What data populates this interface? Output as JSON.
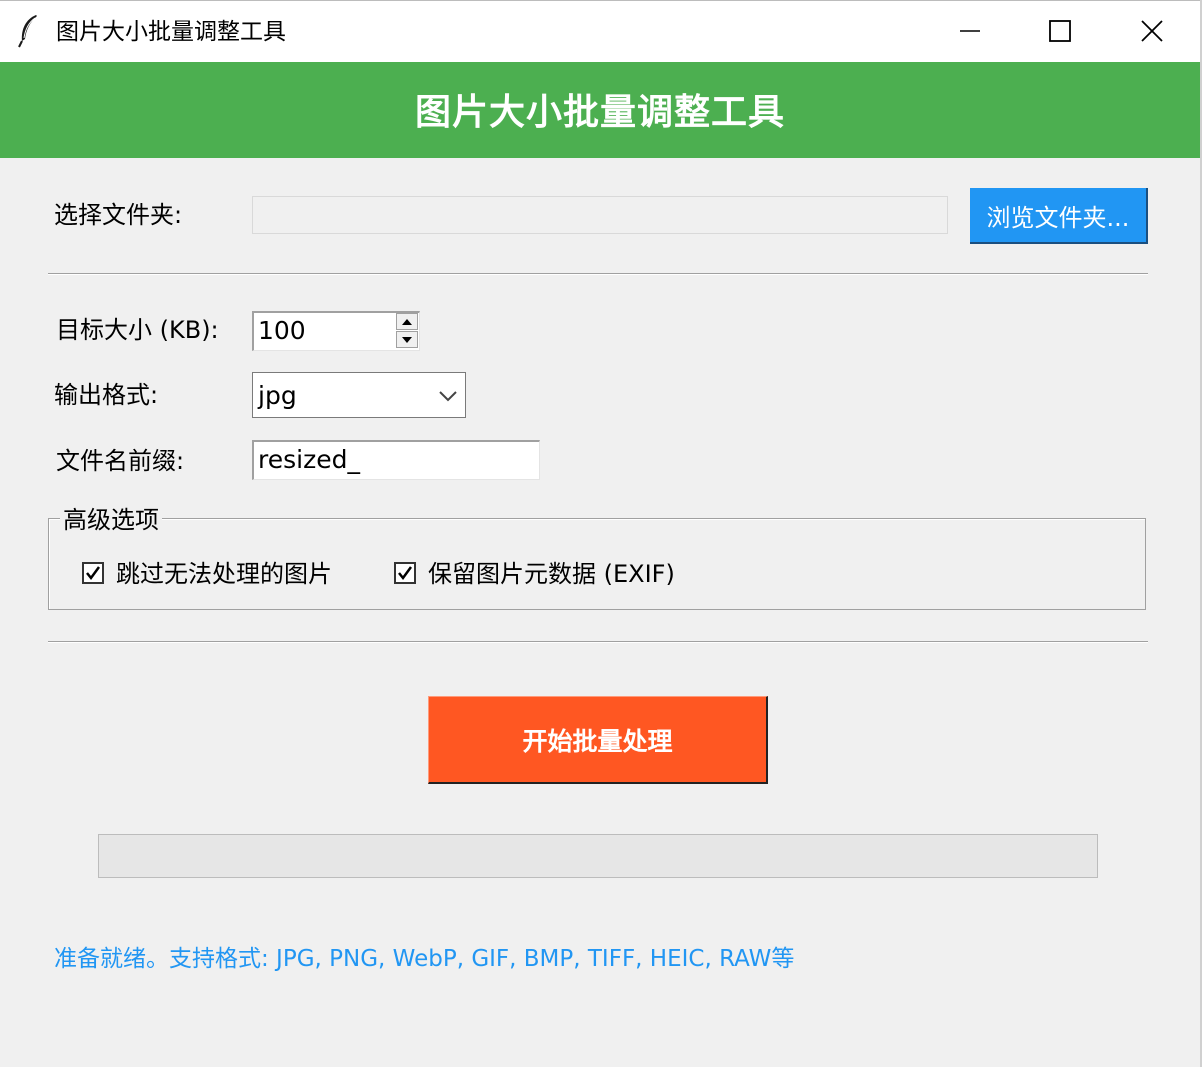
{
  "window": {
    "title": "图片大小批量调整工具",
    "controls": [
      "minimize-icon",
      "maximize-icon",
      "close-icon"
    ]
  },
  "header": {
    "title": "图片大小批量调整工具",
    "color": "#4caf50"
  },
  "folder": {
    "label": "选择文件夹:",
    "value": "",
    "browse_label": "浏览文件夹...",
    "browse_color": "#2196f3"
  },
  "settings": {
    "target_size_label": "目标大小 (KB):",
    "target_size_value": "100",
    "format_label": "输出格式:",
    "format_value": "jpg",
    "prefix_label": "文件名前缀:",
    "prefix_value": "resized_"
  },
  "advanced": {
    "title": "高级选项",
    "options": [
      {
        "label": "跳过无法处理的图片",
        "checked": true
      },
      {
        "label": "保留图片元数据 (EXIF)",
        "checked": true
      }
    ]
  },
  "action": {
    "start_label": "开始批量处理",
    "color": "#ff5722"
  },
  "progress": {
    "value": 0
  },
  "status": {
    "text": "准备就绪。支持格式: JPG, PNG, WebP, GIF, BMP, TIFF, HEIC, RAW等",
    "color": "#2196f3"
  }
}
